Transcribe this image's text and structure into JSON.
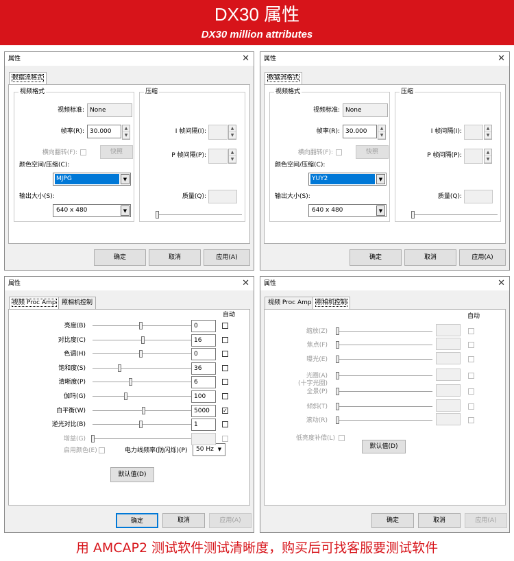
{
  "banner": {
    "title": "DX30 属性",
    "subtitle": "DX30  million attributes"
  },
  "footer": {
    "text": "用 AMCAP2 测试软件测试清晰度，购买后可找客服要测试软件"
  },
  "colors": {
    "banner_bg": "#d7141a",
    "selection": "#0078d7"
  },
  "icons": {
    "close": "close-icon",
    "dropdown": "chevron-down-icon"
  },
  "stream_dialogs": [
    {
      "title": "属性",
      "tab": "数据流格式",
      "video_group": "视频格式",
      "standard_label": "视频标准:",
      "standard_value": "None",
      "framerate_label": "帧率(R):",
      "framerate_value": "30.000",
      "flip_label": "横向翻转(F):",
      "snapshot_label": "快照",
      "colorspace_label": "颜色空间/压缩(C):",
      "colorspace_value": "MJPG",
      "output_label": "输出大小(S):",
      "output_value": "640 x 480",
      "compress_group": "压缩",
      "iframe_label": "I 帧间隔(I):",
      "pframe_label": "P 帧间隔(P):",
      "quality_label": "质量(Q):",
      "ok": "确定",
      "cancel": "取消",
      "apply": "应用(A)"
    },
    {
      "title": "属性",
      "tab": "数据流格式",
      "video_group": "视频格式",
      "standard_label": "视频标准:",
      "standard_value": "None",
      "framerate_label": "帧率(R):",
      "framerate_value": "30.000",
      "flip_label": "横向翻转(F):",
      "snapshot_label": "快照",
      "colorspace_label": "颜色空间/压缩(C):",
      "colorspace_value": "YUY2",
      "output_label": "输出大小(S):",
      "output_value": "640 x 480",
      "compress_group": "压缩",
      "iframe_label": "I 帧间隔(I):",
      "pframe_label": "P 帧间隔(P):",
      "quality_label": "质量(Q):",
      "ok": "确定",
      "cancel": "取消",
      "apply": "应用(A)"
    }
  ],
  "procamp_dialog": {
    "title": "属性",
    "tabs": [
      "视频 Proc Amp",
      "照相机控制"
    ],
    "auto_label": "自动",
    "rows": [
      {
        "label": "亮度(B)",
        "value": "0",
        "level": 0.48,
        "checked": false,
        "enabled": true
      },
      {
        "label": "对比度(C)",
        "value": "16",
        "level": 0.5,
        "checked": false,
        "enabled": true
      },
      {
        "label": "色调(H)",
        "value": "0",
        "level": 0.48,
        "checked": false,
        "enabled": true
      },
      {
        "label": "饱和度(S)",
        "value": "36",
        "level": 0.27,
        "checked": false,
        "enabled": true
      },
      {
        "label": "清晰度(P)",
        "value": "6",
        "level": 0.38,
        "checked": false,
        "enabled": true
      },
      {
        "label": "伽玛(G)",
        "value": "100",
        "level": 0.33,
        "checked": false,
        "enabled": true
      },
      {
        "label": "白平衡(W)",
        "value": "5000",
        "level": 0.51,
        "checked": true,
        "enabled": true
      },
      {
        "label": "逆光对比(B)",
        "value": "1",
        "level": 0.48,
        "checked": false,
        "enabled": true
      },
      {
        "label": "增益(G)",
        "value": "",
        "level": 0.0,
        "checked": false,
        "enabled": false
      }
    ],
    "color_enable_label": "启用颜色(E)",
    "powerline_label": "电力线频率(防闪烁)(P)",
    "powerline_value": "50 Hz",
    "default_button": "默认值(D)",
    "ok": "确定",
    "cancel": "取消",
    "apply": "应用(A)"
  },
  "camera_dialog": {
    "title": "属性",
    "tabs": [
      "视频 Proc Amp",
      "照相机控制"
    ],
    "auto_label": "自动",
    "rows": [
      {
        "label": "缩放(Z)"
      },
      {
        "label": "焦点(F)"
      },
      {
        "label": "曝光(E)"
      },
      {
        "label": "光圈(A)",
        "sublabel": "(十字光圈)"
      },
      {
        "label": "全景(P)"
      },
      {
        "label": "倾斜(T)"
      },
      {
        "label": "滚动(R)"
      }
    ],
    "low_light_label": "低亮度补偿(L)",
    "default_button": "默认值(D)",
    "ok": "确定",
    "cancel": "取消",
    "apply": "应用(A)"
  }
}
